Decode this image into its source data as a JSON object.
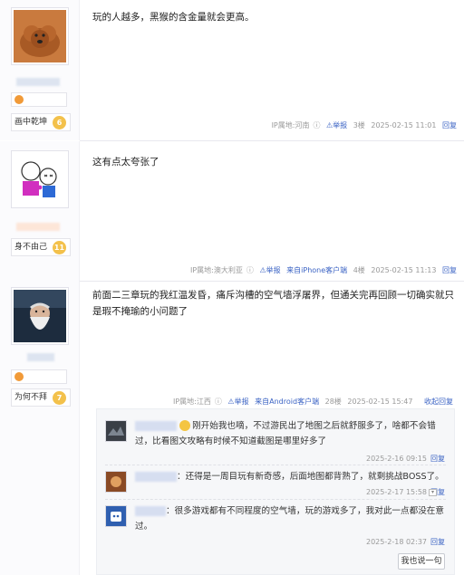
{
  "posts": [
    {
      "content": "玩的人越多，黑猴的含金量就会更高。",
      "level_name": "画中乾坤",
      "level": "6",
      "ip": "IP属地:河南",
      "report": "举报",
      "floor": "3楼",
      "time": "2025-02-15 11:01",
      "reply": "回复"
    },
    {
      "content": "这有点太夸张了",
      "level_name": "身不由己",
      "level": "11",
      "ip": "IP属地:澳大利亚",
      "report": "举报",
      "from": "来自iPhone客户端",
      "floor": "4楼",
      "time": "2025-02-15 11:13",
      "reply": "回复"
    },
    {
      "content": "前面二三章玩的我红温发昏，痛斥沟槽的空气墙浮屠界，但通关完再回顾一切确实就只是瑕不掩瑜的小问题了",
      "level_name": "为何不拜",
      "level": "7",
      "ip": "IP属地:江西",
      "report": "举报",
      "from": "来自Android客户端",
      "floor": "28楼",
      "time": "2025-02-15 15:47",
      "reply": "收起回复"
    }
  ],
  "sub_replies": [
    {
      "text": "刚开始我也嘀，不过游民出了地图之后就舒服多了，啥都不会错过，比看图文攻略有时候不知道截图是哪里好多了",
      "time": "2025-2-16 09:15",
      "reply": "回复"
    },
    {
      "text": "：还得是一周目玩有新奇感，后面地图都背熟了，就剩挑战BOSS了。",
      "time": "2025-2-17 15:58",
      "reply": "回复"
    },
    {
      "text": "：很多游戏都有不同程度的空气墙，玩的游戏多了，我对此一点都没在意过。",
      "time": "2025-2-18 02:37",
      "reply": "回复"
    }
  ],
  "say_button": "我也说一句",
  "colors": {
    "link": "#3b63c4",
    "meta": "#999999",
    "level_badge": "#f3c14b"
  }
}
